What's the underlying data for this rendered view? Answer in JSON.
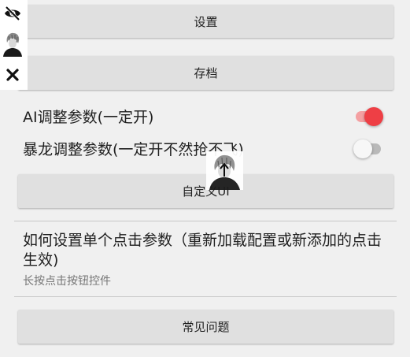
{
  "buttons": {
    "settings": "设置",
    "save": "存档",
    "custom": "自定义UI",
    "faq": "常见问题"
  },
  "toggles": {
    "ai_label": "AI调整参数(一定开)",
    "ai_on": true,
    "dragon_label": "暴龙调整参数(一定开不然抢不飞)",
    "dragon_on": false
  },
  "howto": {
    "title": "如何设置单个点击参数（重新加载配置或新添加的点击生效)",
    "subtitle": "长按点击按钮控件"
  },
  "colors": {
    "accent": "#ee3f45",
    "accent_track": "#f4a0a2",
    "button_bg": "#e0e0e0",
    "page_bg": "#f0f0f0"
  },
  "icons": [
    "eye-off-icon",
    "avatar-icon",
    "close-icon",
    "floating-avatar-icon",
    "arrow-up-icon"
  ]
}
